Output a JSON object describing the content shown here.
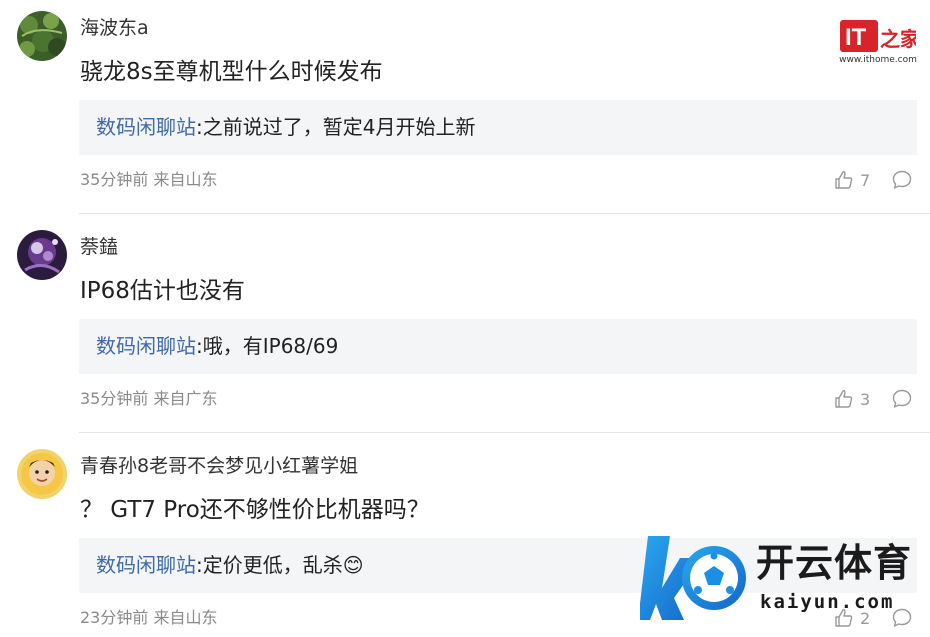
{
  "site_logo": {
    "text": "IT之家",
    "url": "www.ithome.com"
  },
  "comments": [
    {
      "username": "海波东a",
      "content": "骁龙8s至尊机型什么时候发布",
      "reply": {
        "author": "数码闲聊站",
        "separator": ":",
        "text": "之前说过了，暂定4月开始上新"
      },
      "time": "35分钟前",
      "location": "来自山东",
      "likes": "7"
    },
    {
      "username": "萘鎑",
      "content": "IP68估计也没有",
      "reply": {
        "author": "数码闲聊站",
        "separator": ":",
        "text": "哦，有IP68/69"
      },
      "time": "35分钟前",
      "location": "来自广东",
      "likes": "3"
    },
    {
      "username": "青春孙8老哥不会梦见小红薯学姐",
      "content": "？ GT7 Pro还不够性价比机器吗？",
      "reply": {
        "author": "数码闲聊站",
        "separator": ":",
        "text": "定价更低，乱杀😊"
      },
      "time": "23分钟前",
      "location": "来自山东",
      "likes": "2"
    }
  ],
  "watermark": {
    "cn": "开云体育",
    "en": "kaiyun.com"
  },
  "colors": {
    "reply_author": "#3e6aa8",
    "reply_bg": "#f4f5f7",
    "meta": "#8a8a8a",
    "brand_red": "#d8232a",
    "watermark_blue": "#1a8fe3"
  },
  "icons": {
    "like": "thumbs-up-icon",
    "reply": "speech-bubble-icon"
  }
}
